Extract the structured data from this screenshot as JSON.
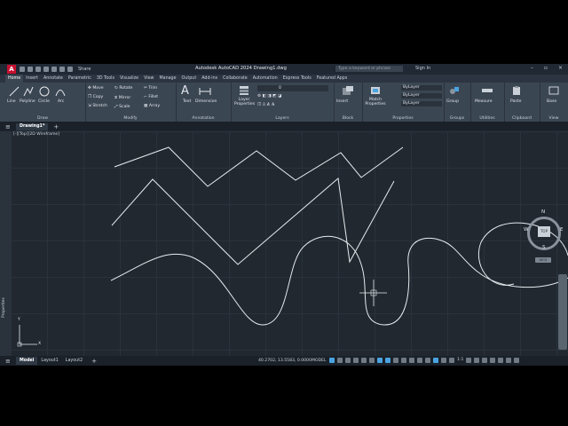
{
  "app": {
    "title": "Autodesk AutoCAD 2024    Drawing1.dwg",
    "search_placeholder": "Type a keyword or phrase",
    "signin": "Sign In",
    "share": "Share",
    "logo": "A"
  },
  "ribbon_tabs": [
    "Home",
    "Insert",
    "Annotate",
    "Parametric",
    "3D Tools",
    "Visualize",
    "View",
    "Manage",
    "Output",
    "Add-ins",
    "Collaborate",
    "Automation",
    "Express Tools",
    "Featured Apps"
  ],
  "panels": {
    "draw": {
      "title": "Draw",
      "tools": [
        "Line",
        "Polyline",
        "Circle",
        "Arc"
      ]
    },
    "modify": {
      "title": "Modify",
      "tools": [
        "Move",
        "Rotate",
        "Trim",
        "Copy",
        "Mirror",
        "Fillet",
        "Stretch",
        "Scale",
        "Array"
      ]
    },
    "annotation": {
      "title": "Annotation",
      "tools": [
        "Text",
        "Dimension"
      ]
    },
    "layers": {
      "title": "Layers",
      "tools": [
        "Layer Properties"
      ],
      "current_layer": "0"
    },
    "block": {
      "title": "Block",
      "tools": [
        "Insert"
      ]
    },
    "properties": {
      "title": "Properties",
      "tools": [
        "Match Properties"
      ],
      "bylayer": "ByLayer"
    },
    "groups": {
      "title": "Groups",
      "tools": [
        "Group"
      ]
    },
    "utilities": {
      "title": "Utilities",
      "tools": [
        "Measure"
      ]
    },
    "clipboard": {
      "title": "Clipboard",
      "tools": [
        "Paste"
      ]
    },
    "view": {
      "title": "View",
      "tools": [
        "Base"
      ]
    }
  },
  "doc_tab": "Drawing1*",
  "view_label": "[-][Top][2D Wireframe]",
  "sidebar_label": "Properties",
  "viewcube": {
    "top": "TOP",
    "n": "N",
    "s": "S",
    "e": "E",
    "w": "W",
    "wcs": "WCS"
  },
  "ucs": {
    "x": "X",
    "y": "Y"
  },
  "status": {
    "layouts": [
      "Model",
      "Layout1",
      "Layout2"
    ],
    "coords": "40.2702, 13.5583, 0.0000",
    "mode": "MODEL",
    "scale": "1:1"
  },
  "colors": {
    "accent": "#4aa3df",
    "canvas": "#212830",
    "stroke": "#e8ecef",
    "logo": "#c8102e"
  }
}
